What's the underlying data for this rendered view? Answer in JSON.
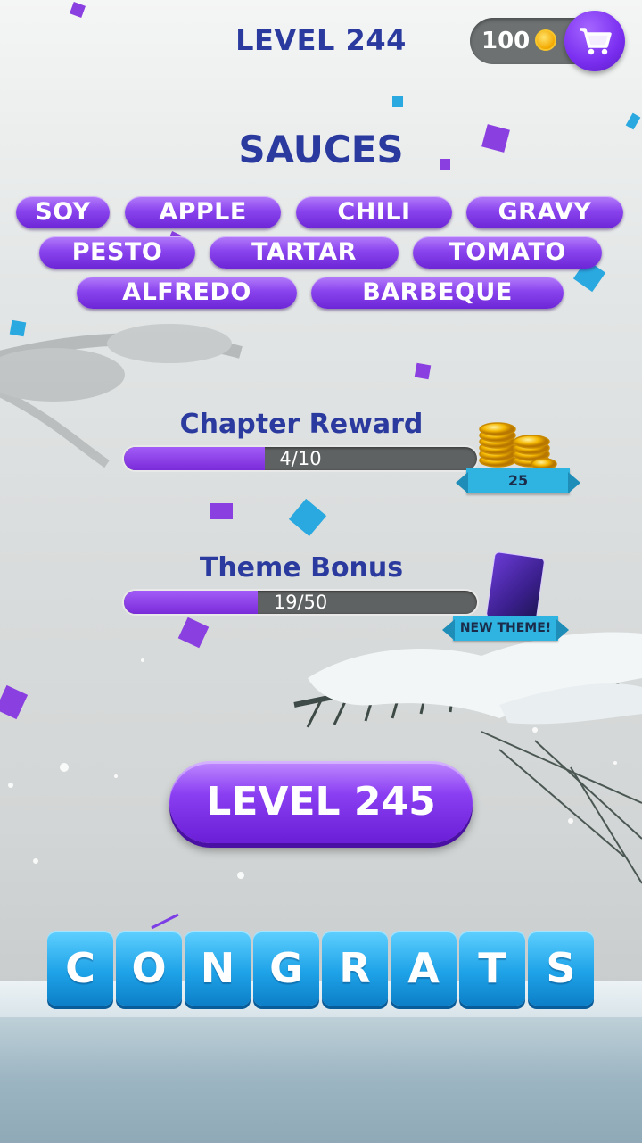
{
  "header": {
    "level_title": "LEVEL 244",
    "coins": "100",
    "coin_icon": "coin-icon",
    "shop_icon": "shopping-cart-icon"
  },
  "category": "SAUCES",
  "words": [
    "SOY",
    "APPLE",
    "CHILI",
    "GRAVY",
    "PESTO",
    "TARTAR",
    "TOMATO",
    "ALFREDO",
    "BARBEQUE"
  ],
  "chapter_reward": {
    "title": "Chapter Reward",
    "progress_text": "4/10",
    "progress": 0.4,
    "reward_value": "25",
    "reward_icon": "gold-coins-icon"
  },
  "theme_bonus": {
    "title": "Theme Bonus",
    "progress_text": "19/50",
    "progress": 0.38,
    "reward_label": "NEW THEME!",
    "reward_icon": "theme-card-icon"
  },
  "next_button": "LEVEL 245",
  "congrats_letters": [
    "C",
    "O",
    "N",
    "G",
    "R",
    "A",
    "T",
    "S"
  ],
  "colors": {
    "title_blue": "#2b3a9e",
    "purple": "#8a44ee",
    "tile_blue": "#1fa3e8",
    "ribbon_blue": "#2fb3e0"
  }
}
